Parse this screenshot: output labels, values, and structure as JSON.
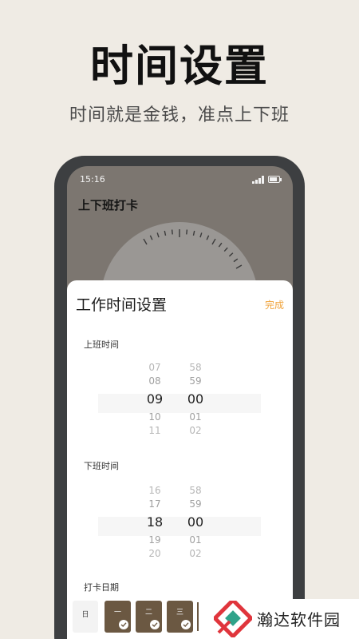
{
  "banner": {
    "title": "时间设置",
    "subtitle": "时间就是金钱，准点上下班"
  },
  "status_bar": {
    "time": "15:16"
  },
  "app": {
    "title": "上下班打卡"
  },
  "sheet": {
    "title": "工作时间设置",
    "done_label": "完成",
    "start": {
      "label": "上班时间",
      "hours": [
        "07",
        "08",
        "09",
        "10",
        "11"
      ],
      "minutes": [
        "58",
        "59",
        "00",
        "01",
        "02"
      ]
    },
    "end": {
      "label": "下班时间",
      "hours": [
        "16",
        "17",
        "18",
        "19",
        "20"
      ],
      "minutes": [
        "58",
        "59",
        "00",
        "01",
        "02"
      ]
    },
    "days_label": "打卡日期",
    "days": [
      {
        "label": "日",
        "selected": false
      },
      {
        "label": "一",
        "selected": true
      },
      {
        "label": "二",
        "selected": true
      },
      {
        "label": "三",
        "selected": true
      }
    ]
  },
  "watermark": {
    "text": "瀚达软件园"
  },
  "colors": {
    "background": "#efebe4",
    "accent": "#f0a33a",
    "day_selected": "#6b5842",
    "phone_frame": "#3d3f41"
  }
}
